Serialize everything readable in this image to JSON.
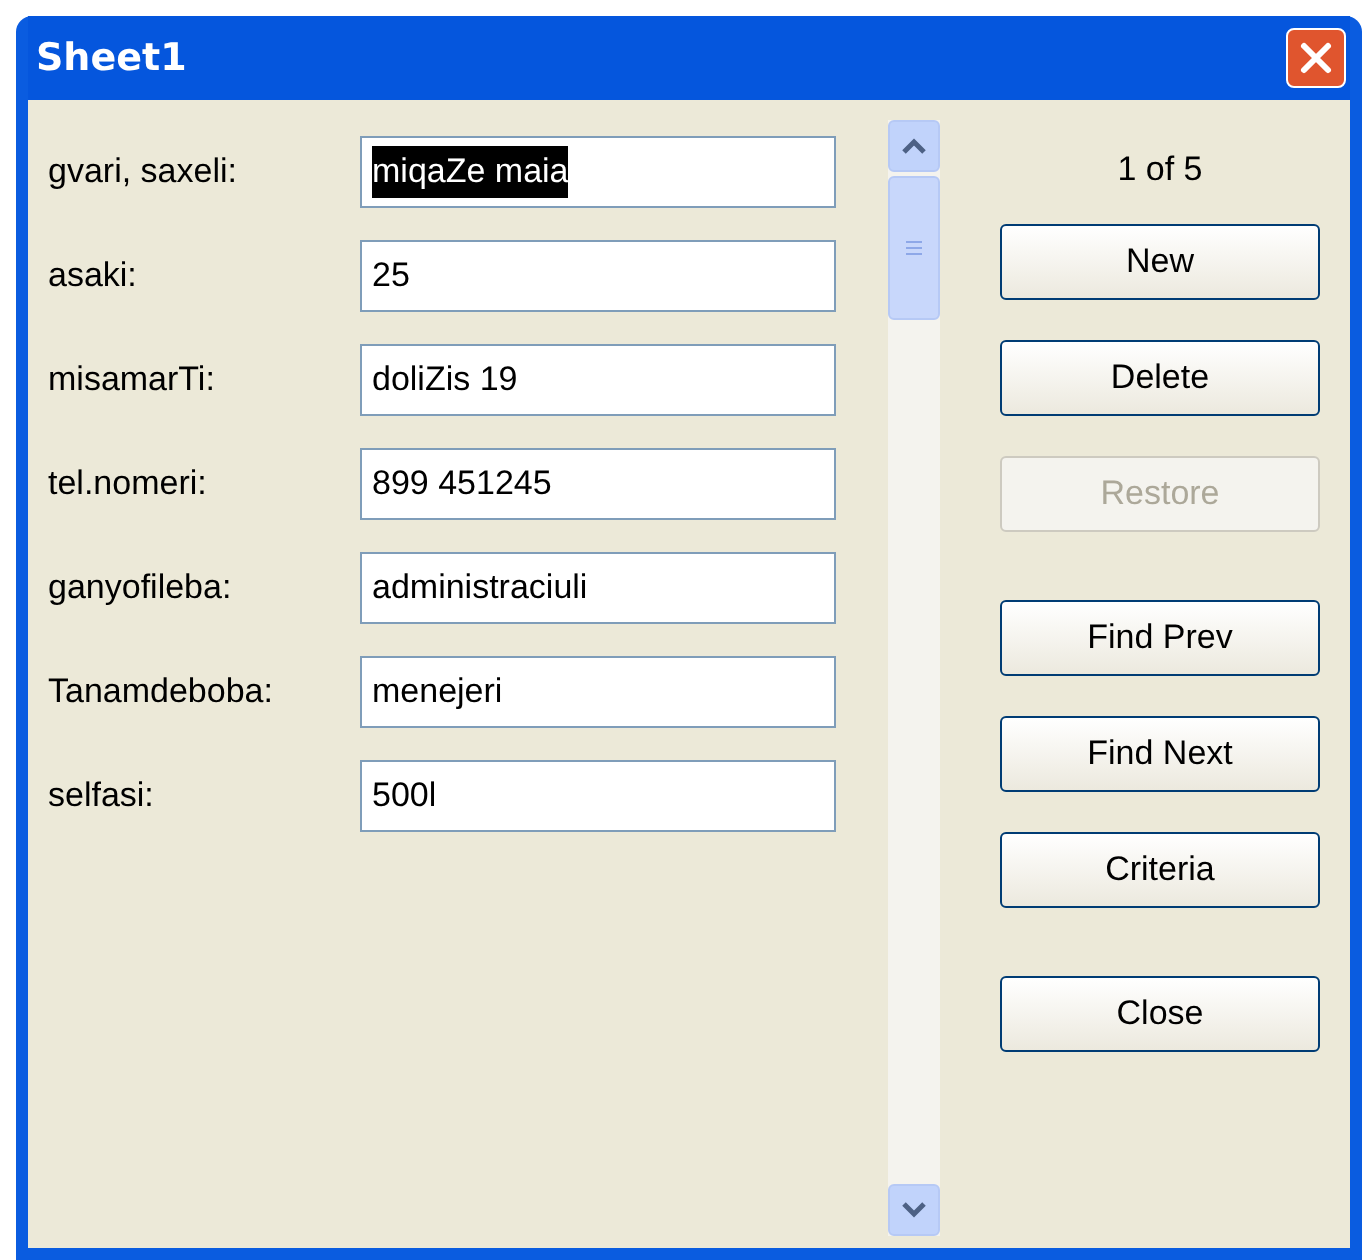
{
  "window": {
    "title": "Sheet1"
  },
  "fields": [
    {
      "label": "gvari, saxeli:",
      "value": "miqaZe maia",
      "text_selected": true
    },
    {
      "label": "asaki:",
      "value": "25",
      "text_selected": false
    },
    {
      "label": "misamarTi:",
      "value": "doliZis 19",
      "text_selected": false
    },
    {
      "label": "tel.nomeri:",
      "value": "899 451245",
      "text_selected": false
    },
    {
      "label": "ganyofileba:",
      "value": "administraciuli",
      "text_selected": false
    },
    {
      "label": "Tanamdeboba:",
      "value": "menejeri",
      "text_selected": false
    },
    {
      "label": "selfasi:",
      "value": "500l",
      "text_selected": false
    }
  ],
  "record_counter": "1 of 5",
  "button_groups": [
    [
      {
        "label": "New",
        "disabled": false
      },
      {
        "label": "Delete",
        "disabled": false
      },
      {
        "label": "Restore",
        "disabled": true
      }
    ],
    [
      {
        "label": "Find Prev",
        "disabled": false
      },
      {
        "label": "Find Next",
        "disabled": false
      },
      {
        "label": "Criteria",
        "disabled": false
      }
    ],
    [
      {
        "label": "Close",
        "disabled": false
      }
    ]
  ]
}
